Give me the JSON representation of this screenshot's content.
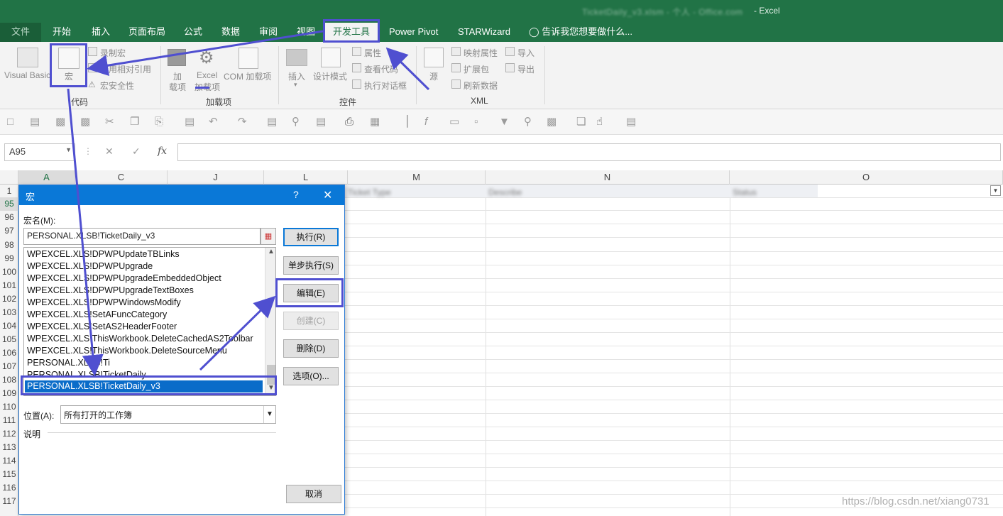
{
  "window": {
    "document_title": "TicketDaily_v3.xlsm - 个人 - Office.com",
    "app_name": "- Excel"
  },
  "ribbon": {
    "tabs": [
      {
        "label": "文件",
        "active": false
      },
      {
        "label": "开始",
        "active": false
      },
      {
        "label": "插入",
        "active": false
      },
      {
        "label": "页面布局",
        "active": false
      },
      {
        "label": "公式",
        "active": false
      },
      {
        "label": "数据",
        "active": false
      },
      {
        "label": "审阅",
        "active": false
      },
      {
        "label": "视图",
        "active": false
      },
      {
        "label": "开发工具",
        "active": true
      },
      {
        "label": "Power Pivot",
        "active": false
      },
      {
        "label": "STARWizard",
        "active": false
      }
    ],
    "tell_me": "告诉我您想要做什么...",
    "groups": {
      "code": {
        "label": "代码",
        "visual_basic": "Visual Basic",
        "macros": "宏",
        "record": "录制宏",
        "relative": "使用相对引用",
        "security": "宏安全性"
      },
      "addins": {
        "label": "加载项",
        "addins_l1": "加",
        "addins_l2": "载项",
        "excel_l1": "Excel",
        "excel_l2": "加载项",
        "com": "COM 加载项"
      },
      "controls": {
        "label": "控件",
        "insert": "插入",
        "design": "设计模式",
        "properties": "属性",
        "view_code": "查看代码",
        "run_dialog": "执行对话框"
      },
      "xml": {
        "label": "XML",
        "source": "源",
        "map_props": "映射属性",
        "expansion": "扩展包",
        "refresh": "刷新数据",
        "import": "导入",
        "export": "导出"
      }
    }
  },
  "formula_bar": {
    "name_box": "A95",
    "fx": "fx",
    "content": ""
  },
  "grid": {
    "columns": [
      "A",
      "C",
      "J",
      "L",
      "M",
      "N",
      "O"
    ],
    "rows": [
      "1",
      "95",
      "96",
      "97",
      "98",
      "99",
      "100",
      "101",
      "102",
      "103",
      "104",
      "105",
      "106",
      "107",
      "108",
      "109",
      "110",
      "111",
      "112",
      "113",
      "114",
      "115",
      "116",
      "117"
    ],
    "header_blurred": [
      "Ticket Type",
      "Describe",
      "Status"
    ]
  },
  "dialog": {
    "title": "宏",
    "help": "?",
    "close": "✕",
    "macro_name_label": "宏名(M):",
    "macro_name_value": "PERSONAL.XLSB!TicketDaily_v3",
    "macros": [
      "WPEXCEL.XLS!DPWPUpdateTBLinks",
      "WPEXCEL.XLS!DPWPUpgrade",
      "WPEXCEL.XLS!DPWPUpgradeEmbeddedObject",
      "WPEXCEL.XLS!DPWPUpgradeTextBoxes",
      "WPEXCEL.XLS!DPWPWindowsModify",
      "WPEXCEL.XLS!SetAFuncCategory",
      "WPEXCEL.XLS!SetAS2HeaderFooter",
      "WPEXCEL.XLS!ThisWorkbook.DeleteCachedAS2Toolbar",
      "WPEXCEL.XLS!ThisWorkbook.DeleteSourceMenu",
      "PERSONAL.XLSB!Ti",
      "PERSONAL.XLSB!TicketDaily",
      "PERSONAL.XLSB!TicketDaily_v3"
    ],
    "selected_index": 11,
    "buttons": {
      "run": "执行(R)",
      "step": "单步执行(S)",
      "edit": "编辑(E)",
      "create": "创建(C)",
      "delete": "删除(D)",
      "options": "选项(O)...",
      "cancel": "取消"
    },
    "location_label": "位置(A):",
    "location_value": "所有打开的工作簿",
    "description_label": "说明"
  },
  "watermark": "https://blog.csdn.net/xiang0731",
  "colors": {
    "excel_green": "#217346",
    "dialog_blue": "#0a78d7",
    "highlight": "#4f4fd0"
  }
}
